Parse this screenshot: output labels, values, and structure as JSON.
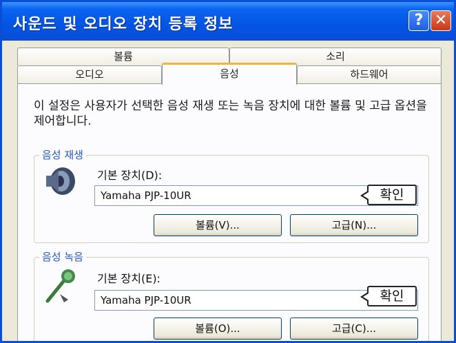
{
  "window": {
    "title": "사운드 및 오디오 장치 등록 정보",
    "help_label": "?",
    "close_label": "✕"
  },
  "tabs": {
    "row_back": [
      {
        "label": "볼륨"
      },
      {
        "label": "소리"
      }
    ],
    "row_front": [
      {
        "label": "오디오"
      },
      {
        "label": "음성",
        "active": true
      },
      {
        "label": "하드웨어"
      }
    ]
  },
  "description": "이 설정은 사용자가 선택한 음성 재생 또는 녹음 장치에 대한 볼륨 및 고급 옵션을 제어합니다.",
  "playback": {
    "group_title": "음성 재생",
    "icon": "speaker-icon",
    "default_device_label": "기본 장치(D):",
    "device": "Yamaha PJP-10UR",
    "volume_button": "볼륨(V)...",
    "advanced_button": "고급(N)...",
    "callout": "확인"
  },
  "recording": {
    "group_title": "음성 녹음",
    "icon": "microphone-icon",
    "default_device_label": "기본 장치(E):",
    "device": "Yamaha PJP-10UR",
    "volume_button": "볼륨(O)...",
    "advanced_button": "고급(C)...",
    "callout": "확인"
  },
  "colors": {
    "titlebar": "#0a4ed8",
    "active_tab_accent": "#f3b33d",
    "group_title": "#2255c4"
  }
}
